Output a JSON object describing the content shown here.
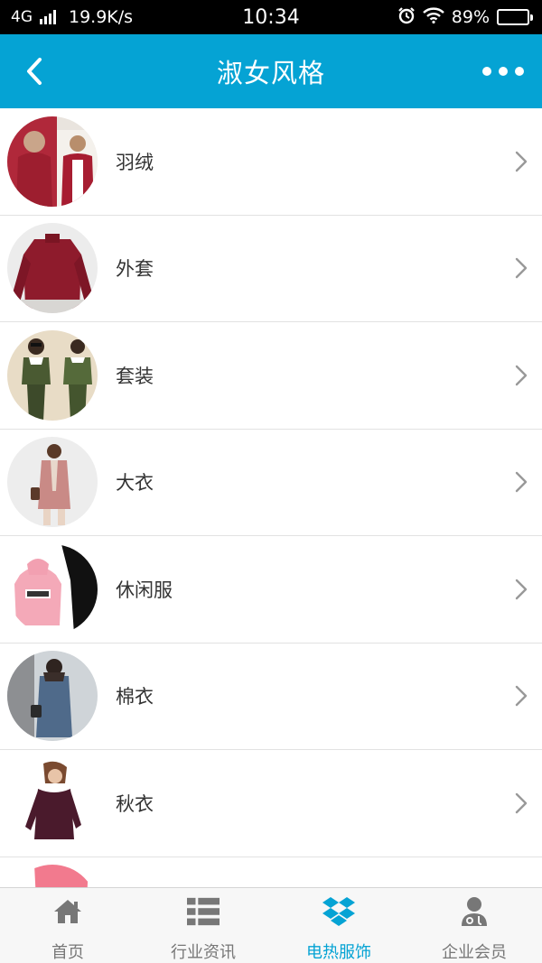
{
  "status_bar": {
    "network": "4G",
    "speed": "19.9K/s",
    "time": "10:34",
    "battery": "89%",
    "battery_level": 0.89,
    "icons": [
      "signal-icon",
      "alarm-icon",
      "wifi-icon",
      "battery-icon"
    ]
  },
  "header": {
    "title": "淑女风格",
    "back_icon": "chevron-left-icon",
    "more_icon": "more-dots-icon"
  },
  "list": {
    "items": [
      {
        "label": "羽绒"
      },
      {
        "label": "外套"
      },
      {
        "label": "套装"
      },
      {
        "label": "大衣"
      },
      {
        "label": "休闲服"
      },
      {
        "label": "棉衣"
      },
      {
        "label": "秋衣"
      }
    ]
  },
  "tab_bar": {
    "tabs": [
      {
        "label": "首页",
        "icon": "home-icon",
        "active": false
      },
      {
        "label": "行业资讯",
        "icon": "list-icon",
        "active": false
      },
      {
        "label": "电热服饰",
        "icon": "dropbox-icon",
        "active": true
      },
      {
        "label": "企业会员",
        "icon": "user-doctor-icon",
        "active": false
      }
    ]
  },
  "colors": {
    "accent": "#05a3d4",
    "status_bar": "#000000",
    "text": "#333333",
    "tab_inactive": "#777777"
  }
}
